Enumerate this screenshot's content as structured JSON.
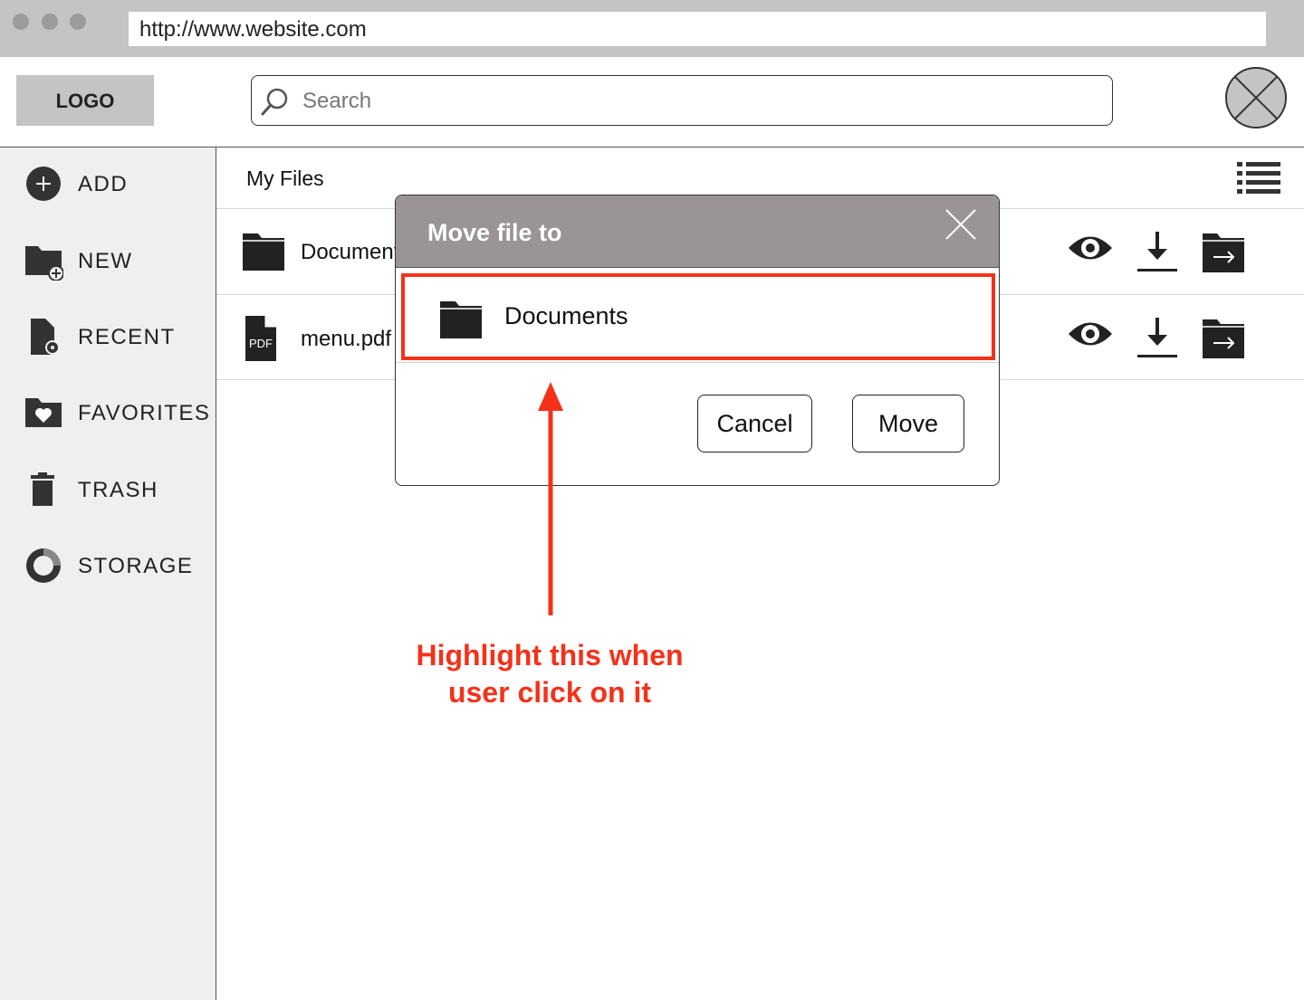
{
  "browser": {
    "url": "http://www.website.com"
  },
  "header": {
    "logo": "LOGO",
    "search_placeholder": "Search",
    "avatar_icon": "placeholder-avatar-icon"
  },
  "sidebar": {
    "items": [
      {
        "label": "ADD",
        "icon": "plus-circle-icon"
      },
      {
        "label": "NEW",
        "icon": "new-folder-icon"
      },
      {
        "label": "RECENT",
        "icon": "recent-file-icon"
      },
      {
        "label": "FAVORITES",
        "icon": "favorite-folder-icon"
      },
      {
        "label": "TRASH",
        "icon": "trash-icon"
      },
      {
        "label": "STORAGE",
        "icon": "storage-pie-icon"
      }
    ]
  },
  "main": {
    "title": "My Files",
    "view_icon": "list-view-icon",
    "files": [
      {
        "name": "Documents",
        "type": "folder",
        "icon": "folder-icon"
      },
      {
        "name": "menu.pdf",
        "type": "pdf",
        "icon": "pdf-file-icon",
        "badge": "PDF"
      }
    ],
    "actions": [
      "view-icon",
      "download-icon",
      "move-to-folder-icon"
    ]
  },
  "modal": {
    "title": "Move file to",
    "close_icon": "close-icon",
    "option_label": "Documents",
    "cancel_label": "Cancel",
    "move_label": "Move"
  },
  "annotation": {
    "text_line1": "Highlight this when",
    "text_line2": "user click on it",
    "color": "#f5311a"
  }
}
